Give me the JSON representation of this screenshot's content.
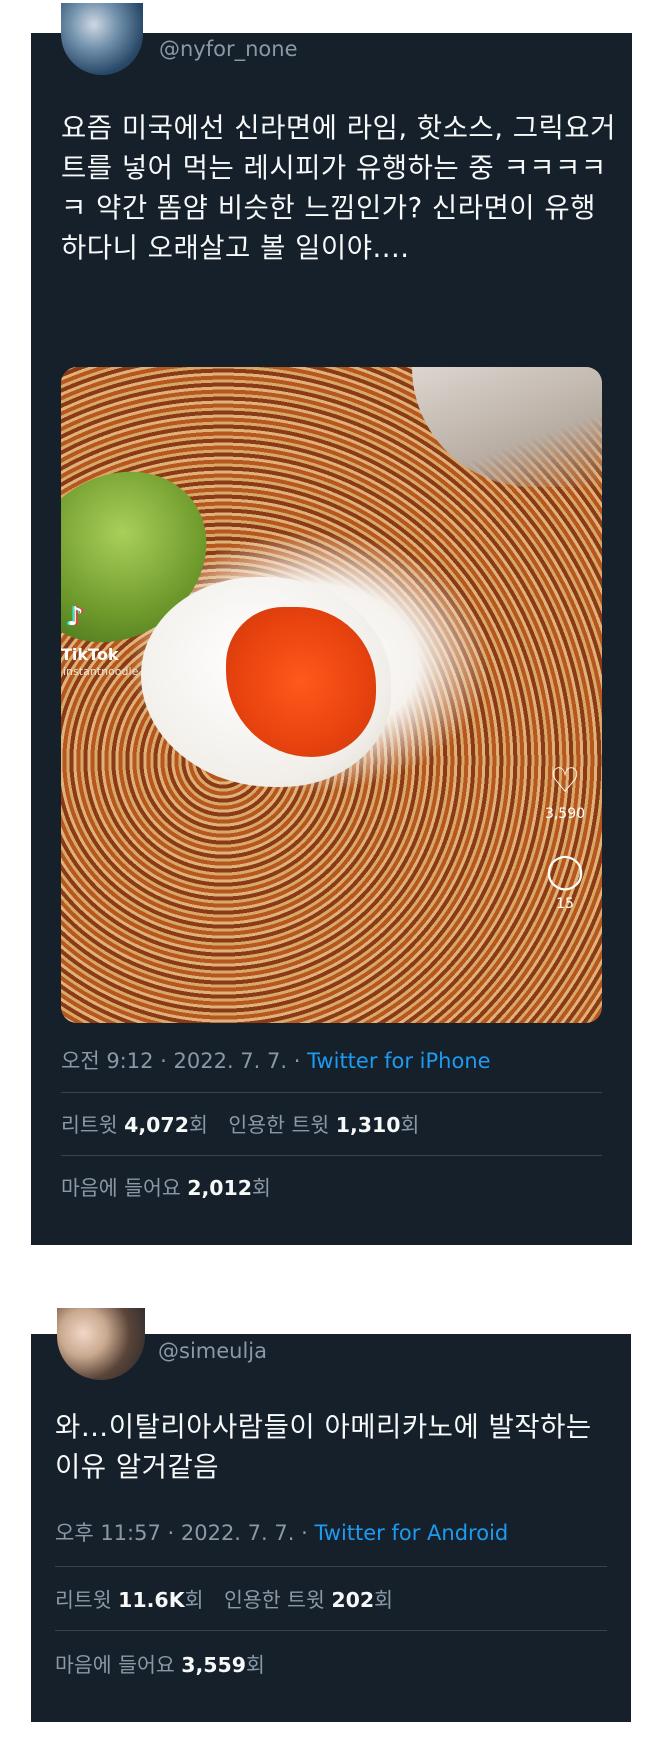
{
  "tweets": [
    {
      "handle": "@nyfor_none",
      "text": "요즘 미국에선 신라면에 라임, 핫소스, 그릭요거트를 넣어 먹는 레시피가 유행하는 중 ㅋㅋㅋㅋㅋ 약간 똠얌 비슷한 느낌인가? 신라면이 유행하다니 오래살고 볼 일이야....",
      "media": {
        "tiktok_label": "TikTok",
        "tiktok_user": "instantnoodle",
        "likes": "3,590",
        "comments": "15"
      },
      "time": "오전 9:12 · 2022. 7. 7. · ",
      "source": "Twitter for iPhone",
      "retweet_label": "리트윗 ",
      "retweet_count": "4,072",
      "count_suffix": "회",
      "quote_label": "인용한 트윗 ",
      "quote_count": "1,310",
      "like_label": "마음에 들어요 ",
      "like_count": "2,012"
    },
    {
      "handle": "@simeulja",
      "text": "와…이탈리아사람들이 아메리카노에 발작하는 이유 알거같음",
      "time": "오후 11:57 · 2022. 7. 7. · ",
      "source": "Twitter for Android",
      "retweet_label": "리트윗 ",
      "retweet_count": "11.6K",
      "count_suffix": "회",
      "quote_label": "인용한 트윗 ",
      "quote_count": "202",
      "like_label": "마음에 들어요 ",
      "like_count": "3,559"
    }
  ],
  "colors": {
    "background": "#15202b",
    "text": "#f7f9f9",
    "muted": "#8b98a5",
    "link": "#1d9bf0",
    "divider": "#38444d"
  }
}
